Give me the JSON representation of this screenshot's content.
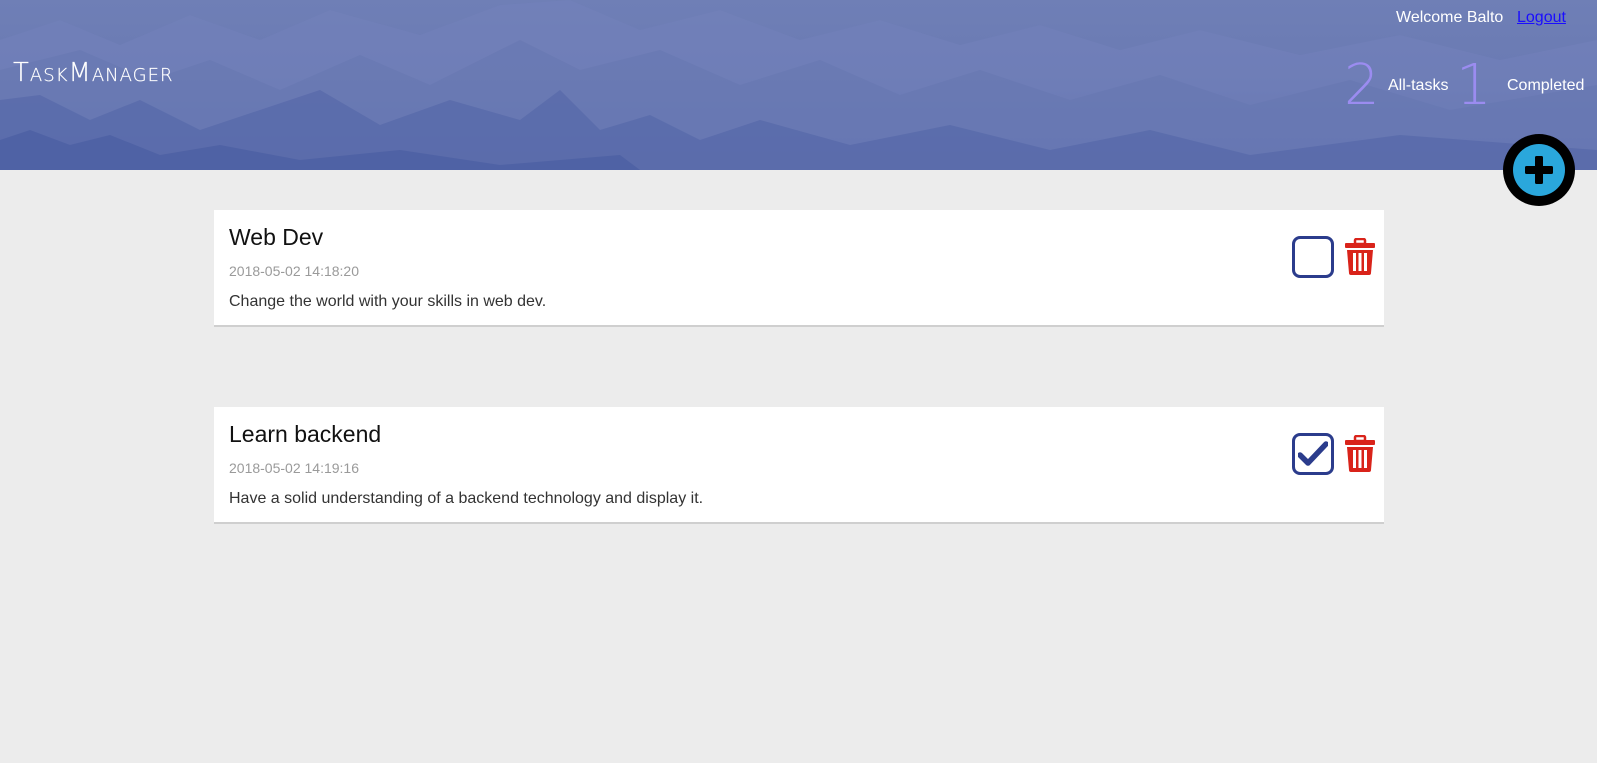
{
  "header": {
    "logo": "TaskManager",
    "welcome": "Welcome Balto",
    "logout": "Logout",
    "stats": {
      "all_count": "2",
      "all_label": "All-tasks",
      "completed_count": "1",
      "completed_label": "Completed"
    },
    "add_button_icon": "plus-circle-icon"
  },
  "tasks": [
    {
      "title": "Web Dev",
      "date": "2018-05-02 14:18:20",
      "description": "Change the world with your skills in web dev.",
      "completed": false
    },
    {
      "title": "Learn backend",
      "date": "2018-05-02 14:19:16",
      "description": "Have a solid understanding of a backend technology and display it.",
      "completed": true
    }
  ],
  "colors": {
    "accent": "#2b3c8c",
    "delete": "#d9231a",
    "add_button": "#2aa7dc",
    "stat_number": "#9b8cf0",
    "header_bg": "#6a7ab3"
  }
}
